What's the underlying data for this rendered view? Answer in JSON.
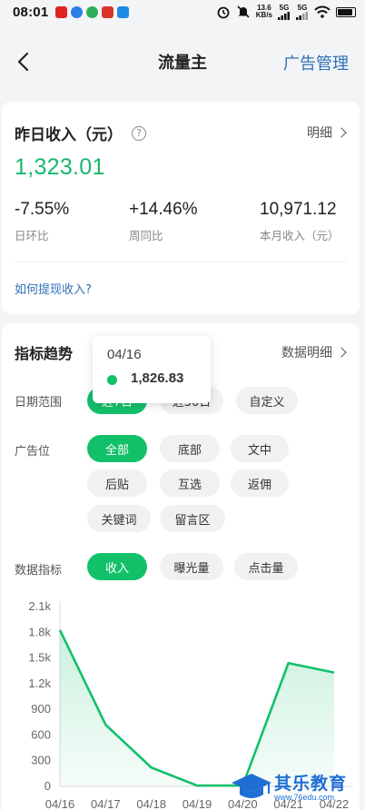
{
  "status_bar": {
    "time": "08:01",
    "net_speed_value": "13.6",
    "net_speed_unit": "KB/s",
    "sim1": "5G",
    "sim2": "5G"
  },
  "nav": {
    "title": "流量主",
    "action": "广告管理"
  },
  "income_card": {
    "title": "昨日收入（元）",
    "detail_label": "明细",
    "amount": "1,323.01",
    "stats": [
      {
        "value": "-7.55%",
        "label": "日环比"
      },
      {
        "value": "+14.46%",
        "label": "周同比"
      },
      {
        "value": "10,971.12",
        "label": "本月收入（元）"
      }
    ],
    "withdraw_link": "如何提现收入?"
  },
  "trend_card": {
    "title": "指标趋势",
    "detail_label": "数据明细",
    "date_range": {
      "label": "日期范围",
      "options": [
        "近7日",
        "近30日",
        "自定义"
      ],
      "selected": "近7日"
    },
    "ad_position": {
      "label": "广告位",
      "options": [
        "全部",
        "底部",
        "文中",
        "后贴",
        "互选",
        "返佣",
        "关键词",
        "留言区"
      ],
      "selected": "全部"
    },
    "metric": {
      "label": "数据指标",
      "options": [
        "收入",
        "曝光量",
        "点击量"
      ],
      "selected": "收入"
    }
  },
  "chart_data": {
    "type": "area",
    "x": [
      "04/16",
      "04/17",
      "04/18",
      "04/19",
      "04/20",
      "04/21",
      "04/22"
    ],
    "values": [
      1826.83,
      720,
      220,
      10,
      10,
      1440,
      1330
    ],
    "y_ticks": [
      "0",
      "300",
      "600",
      "900",
      "1.2k",
      "1.5k",
      "1.8k",
      "2.1k"
    ],
    "ylim": [
      0,
      2100
    ],
    "grid": false,
    "line_color": "#12c06a",
    "tooltip": {
      "date": "04/16",
      "value": "1,826.83"
    }
  },
  "watermark": {
    "text": "其乐教育",
    "url": "www.76edu.com"
  }
}
